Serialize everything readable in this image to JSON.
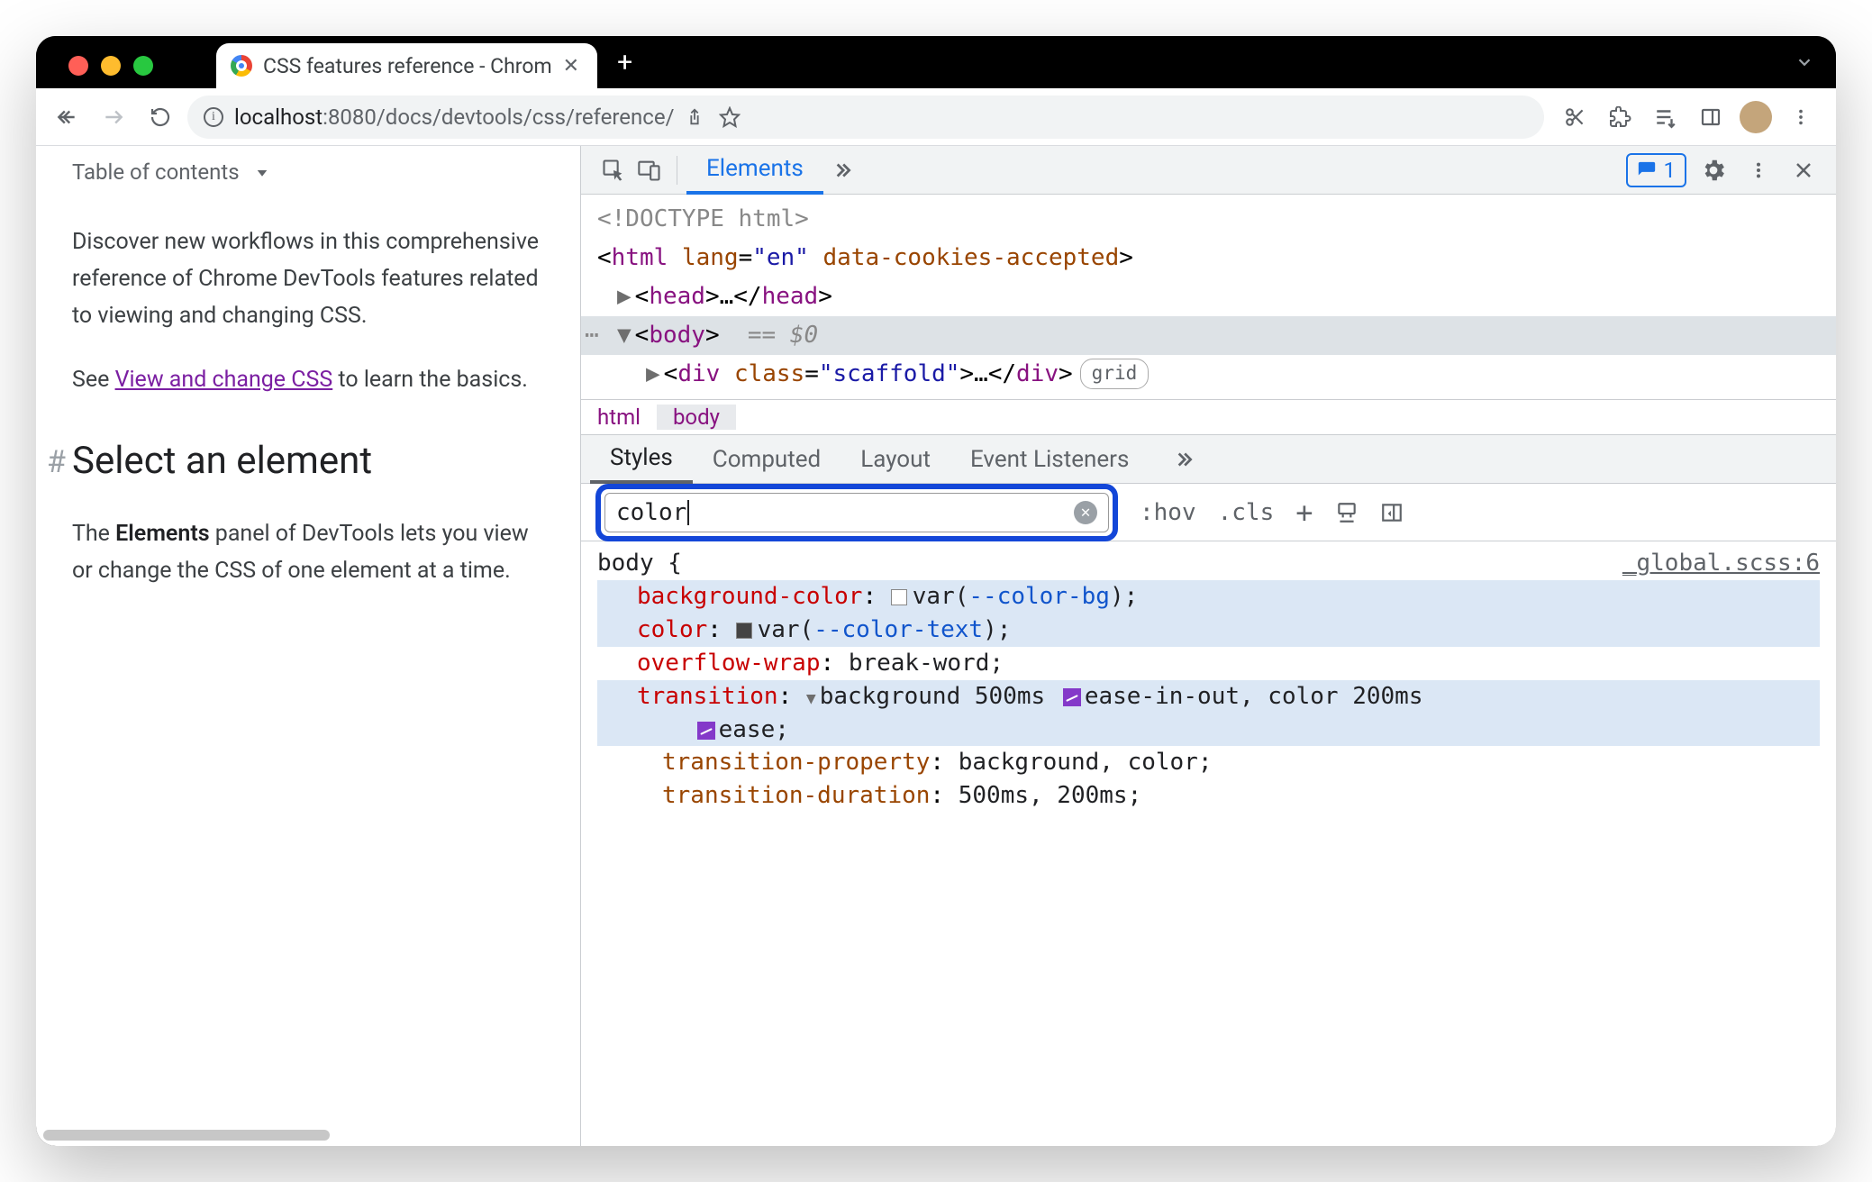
{
  "tab": {
    "title": "CSS features reference - Chrom"
  },
  "address": {
    "host": "localhost",
    "port": ":8080",
    "path": "/docs/devtools/css/reference/"
  },
  "page": {
    "toc": "Table of contents",
    "p1": "Discover new workflows in this comprehensive reference of Chrome DevTools features related to viewing and changing CSS.",
    "p2a": "See ",
    "link": "View and change CSS",
    "p2b": " to learn the basics.",
    "h2": "Select an element",
    "p3a": "The ",
    "bold": "Elements",
    "p3b": " panel of DevTools lets you view or change the CSS of one element at a time."
  },
  "devtools": {
    "tabs": {
      "elements": "Elements"
    },
    "issues": "1",
    "dom": {
      "doctype": "<!DOCTYPE html>",
      "html_open": "html",
      "lang_k": "lang",
      "lang_v": "\"en\"",
      "cookie": "data-cookies-accepted",
      "head": "head",
      "ellip": "…",
      "body": "body",
      "eq": "== ",
      "d0": "$0",
      "div": "div",
      "class_k": "class",
      "class_v": "\"scaffold\"",
      "grid": "grid"
    },
    "crumbs": {
      "html": "html",
      "body": "body"
    },
    "subtabs": {
      "styles": "Styles",
      "computed": "Computed",
      "layout": "Layout",
      "events": "Event Listeners"
    },
    "filter": {
      "value": "color",
      "hov": ":hov",
      "cls": ".cls"
    },
    "style": {
      "selector": "body {",
      "src": "_global.scss:6",
      "p1": {
        "n": "background-color",
        "v1": "var(",
        "var": "--color-bg",
        "v2": ");"
      },
      "p2": {
        "n": "color",
        "v1": "var(",
        "var": "--color-text",
        "v2": ");"
      },
      "p3": {
        "n": "overflow-wrap",
        "v": "break-word;"
      },
      "p4": {
        "n": "transition",
        "v1": "background 500ms ",
        "e1": "ease-in-out",
        "v2": ", color 200ms ",
        "e2": "ease",
        ";": ";"
      },
      "p5": {
        "n": "transition-property",
        "v": "background, color;"
      },
      "p6": {
        "n": "transition-duration",
        "v": "500ms, 200ms;"
      }
    }
  }
}
